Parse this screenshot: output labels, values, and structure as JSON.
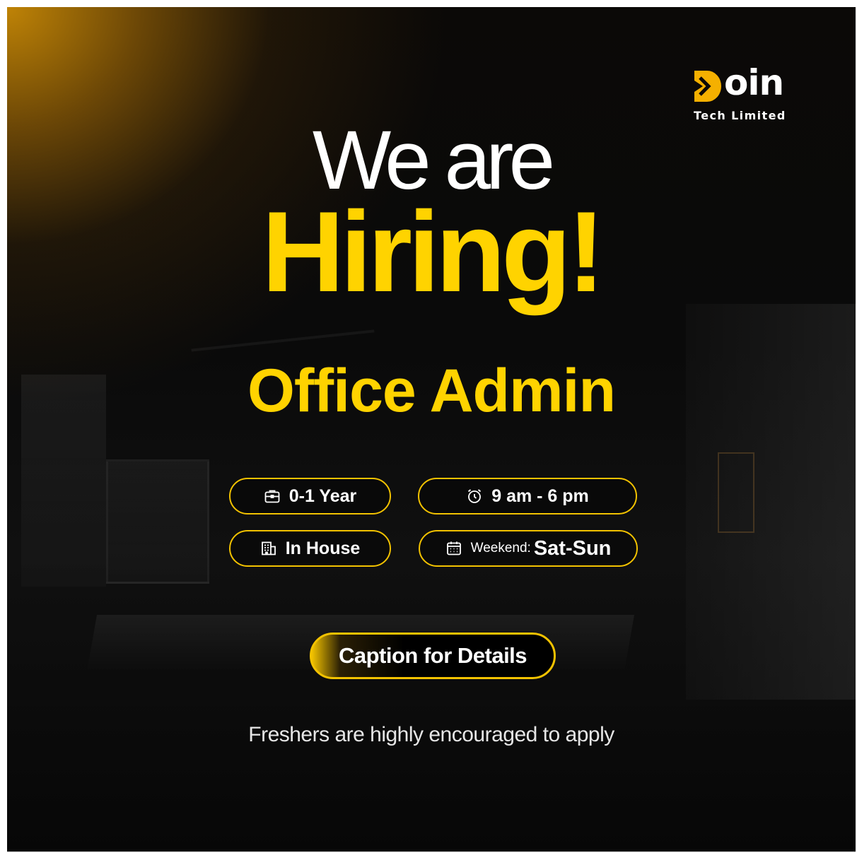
{
  "brand": {
    "logo_word": "oin",
    "logo_subtitle": "Tech Limited",
    "accent_color": "#ffd300",
    "mark_color": "#f5b000"
  },
  "headline": {
    "line1": "We are",
    "line2": "Hiring!"
  },
  "role": "Office Admin",
  "details": {
    "experience": {
      "icon": "briefcase-icon",
      "text": "0-1 Year"
    },
    "hours": {
      "icon": "alarm-clock-icon",
      "text": "9 am - 6 pm"
    },
    "location": {
      "icon": "building-icon",
      "text": "In House"
    },
    "weekend": {
      "icon": "calendar-icon",
      "label": "Weekend:",
      "value": "Sat-Sun"
    }
  },
  "cta": {
    "label": "Caption for Details"
  },
  "footer": {
    "note": "Freshers are highly encouraged to apply"
  }
}
